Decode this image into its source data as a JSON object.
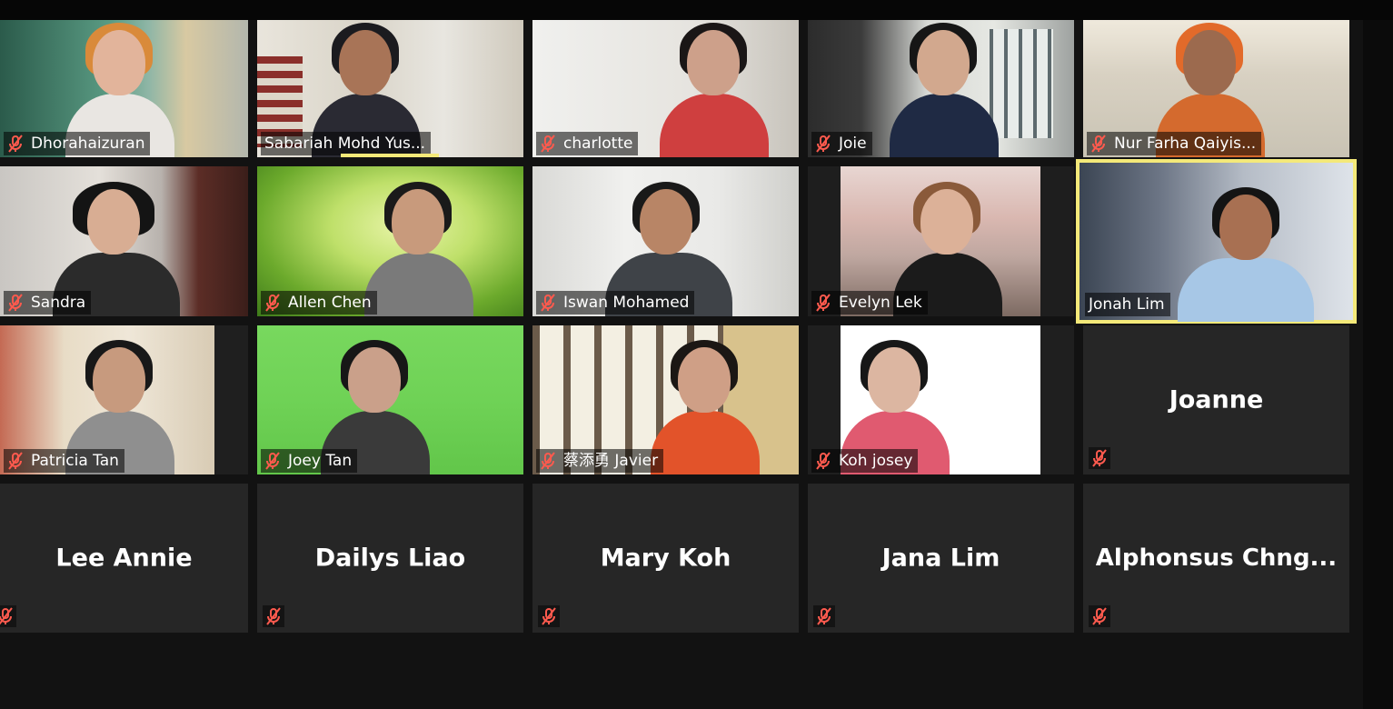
{
  "app": {
    "accent_color": "#f4e979",
    "muted_icon_color": "#ff5a4e"
  },
  "participants": [
    {
      "name": "Dhorahaizuran",
      "muted": true,
      "video": true
    },
    {
      "name": "Sabariah Mohd Yus...",
      "muted": false,
      "video": true,
      "speaking": true
    },
    {
      "name": "charlotte",
      "muted": true,
      "video": true
    },
    {
      "name": "Joie",
      "muted": true,
      "video": true
    },
    {
      "name": "Nur Farha Qaiyis...",
      "muted": true,
      "video": true
    },
    {
      "name": "Sandra",
      "muted": true,
      "video": true
    },
    {
      "name": "Allen Chen",
      "muted": true,
      "video": true
    },
    {
      "name": "Iswan Mohamed",
      "muted": true,
      "video": true
    },
    {
      "name": "Evelyn Lek",
      "muted": true,
      "video": true
    },
    {
      "name": "Jonah Lim",
      "muted": false,
      "video": true,
      "active": true
    },
    {
      "name": "Patricia Tan",
      "muted": true,
      "video": true
    },
    {
      "name": "Joey Tan",
      "muted": true,
      "video": true
    },
    {
      "name": "蔡添勇 Javier",
      "muted": true,
      "video": true
    },
    {
      "name": "Koh josey",
      "muted": true,
      "video": true
    },
    {
      "name": "Joanne",
      "muted": true,
      "video": false
    },
    {
      "name": "Lee Annie",
      "muted": true,
      "video": false
    },
    {
      "name": "Dailys Liao",
      "muted": true,
      "video": false
    },
    {
      "name": "Mary Koh",
      "muted": true,
      "video": false
    },
    {
      "name": "Jana Lim",
      "muted": true,
      "video": false
    },
    {
      "name": "Alphonsus  Chng...",
      "muted": true,
      "video": false
    }
  ]
}
